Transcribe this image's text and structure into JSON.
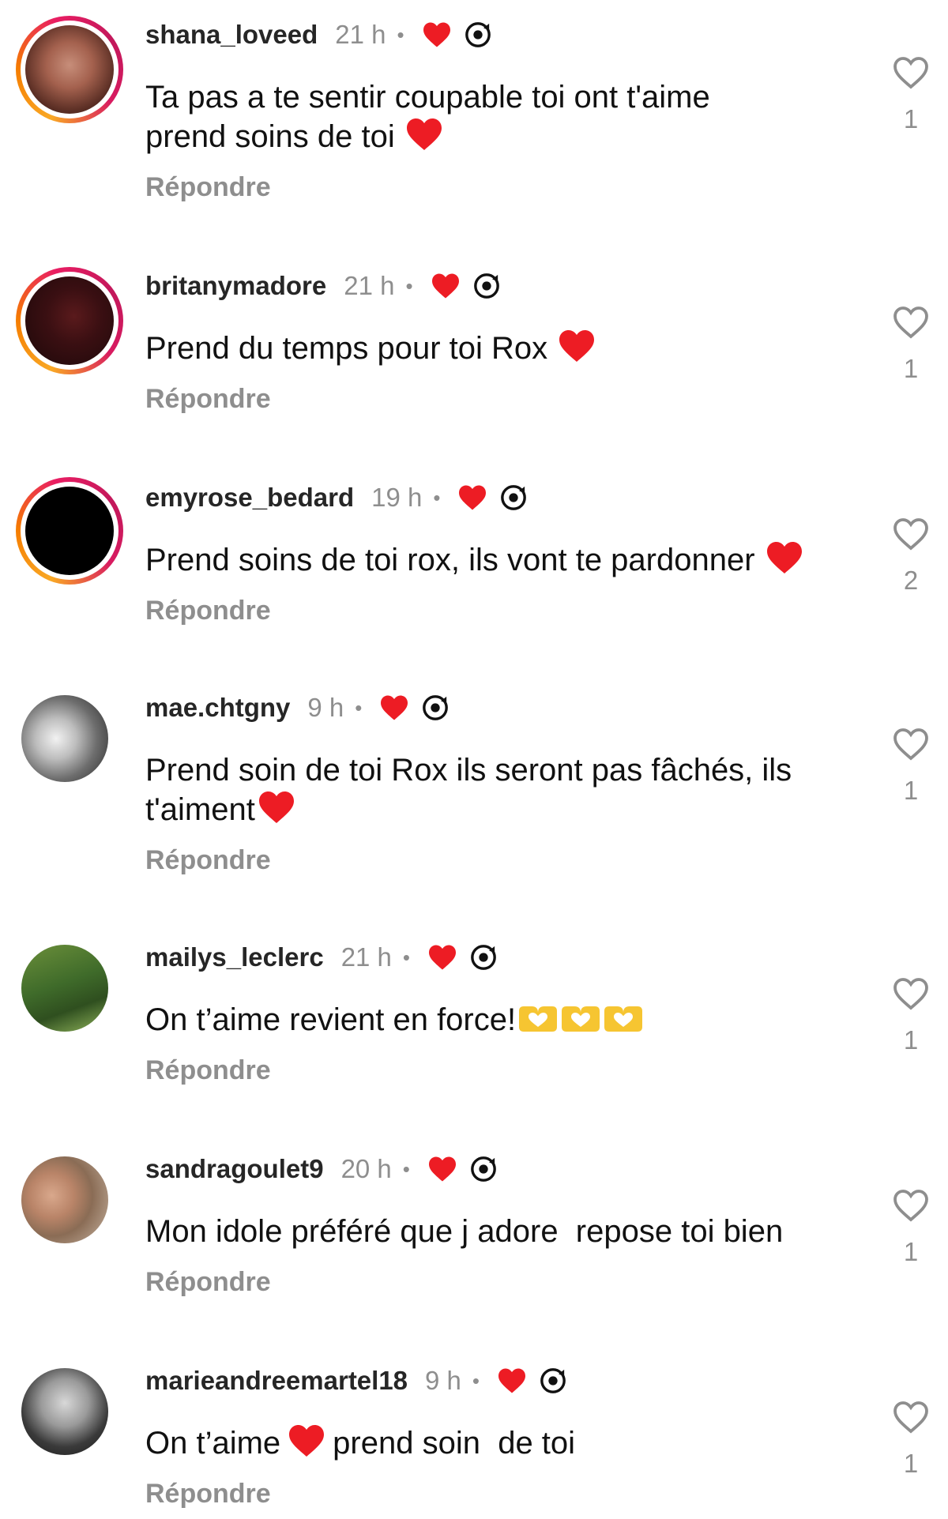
{
  "comments": [
    {
      "username": "shana_loveed",
      "time": "21 h",
      "text_parts": [
        "Ta pas a te sentir coupable toi ont t'aime",
        "prend soins de toi"
      ],
      "reply": "Répondre",
      "likes": "1",
      "story_ring": true
    },
    {
      "username": "britanymadore",
      "time": "21 h",
      "text_parts": [
        "Prend du temps pour toi Rox"
      ],
      "reply": "Répondre",
      "likes": "1",
      "story_ring": true
    },
    {
      "username": "emyrose_bedard",
      "time": "19 h",
      "text_parts": [
        "Prend soins de toi rox, ils vont te pardonner"
      ],
      "reply": "Répondre",
      "likes": "2",
      "story_ring": true
    },
    {
      "username": "mae.chtgny",
      "time": "9 h",
      "text_parts": [
        "Prend soin de toi Rox ils seront pas fâchés, ils",
        "t'aiment"
      ],
      "reply": "Répondre",
      "likes": "1",
      "story_ring": false
    },
    {
      "username": "mailys_leclerc",
      "time": "21 h",
      "text_parts": [
        "On t’aime revient en force!"
      ],
      "reply": "Répondre",
      "likes": "1",
      "story_ring": false
    },
    {
      "username": "sandragoulet9",
      "time": "20 h",
      "text_parts": [
        "Mon idole préféré que j adore  repose toi bien"
      ],
      "reply": "Répondre",
      "likes": "1",
      "story_ring": false
    },
    {
      "username": "marieandreemartel18",
      "time": "9 h",
      "text_parts": [
        "On t’aime",
        "prend soin  de toi"
      ],
      "reply": "Répondre",
      "likes": "1",
      "story_ring": false
    }
  ],
  "separator": "•",
  "icons": {
    "creator_liked": "red-heart-icon",
    "creator_badge": "creator-avatar-badge-icon",
    "like": "heart-outline-icon",
    "emoji_heart": "red-heart-emoji",
    "emoji_hands": "heart-hands-emoji"
  },
  "colors": {
    "username": "#262626",
    "meta_gray": "#8e8e8e",
    "heart_red": "#ed1c24",
    "hands_yellow": "#f6c531"
  }
}
